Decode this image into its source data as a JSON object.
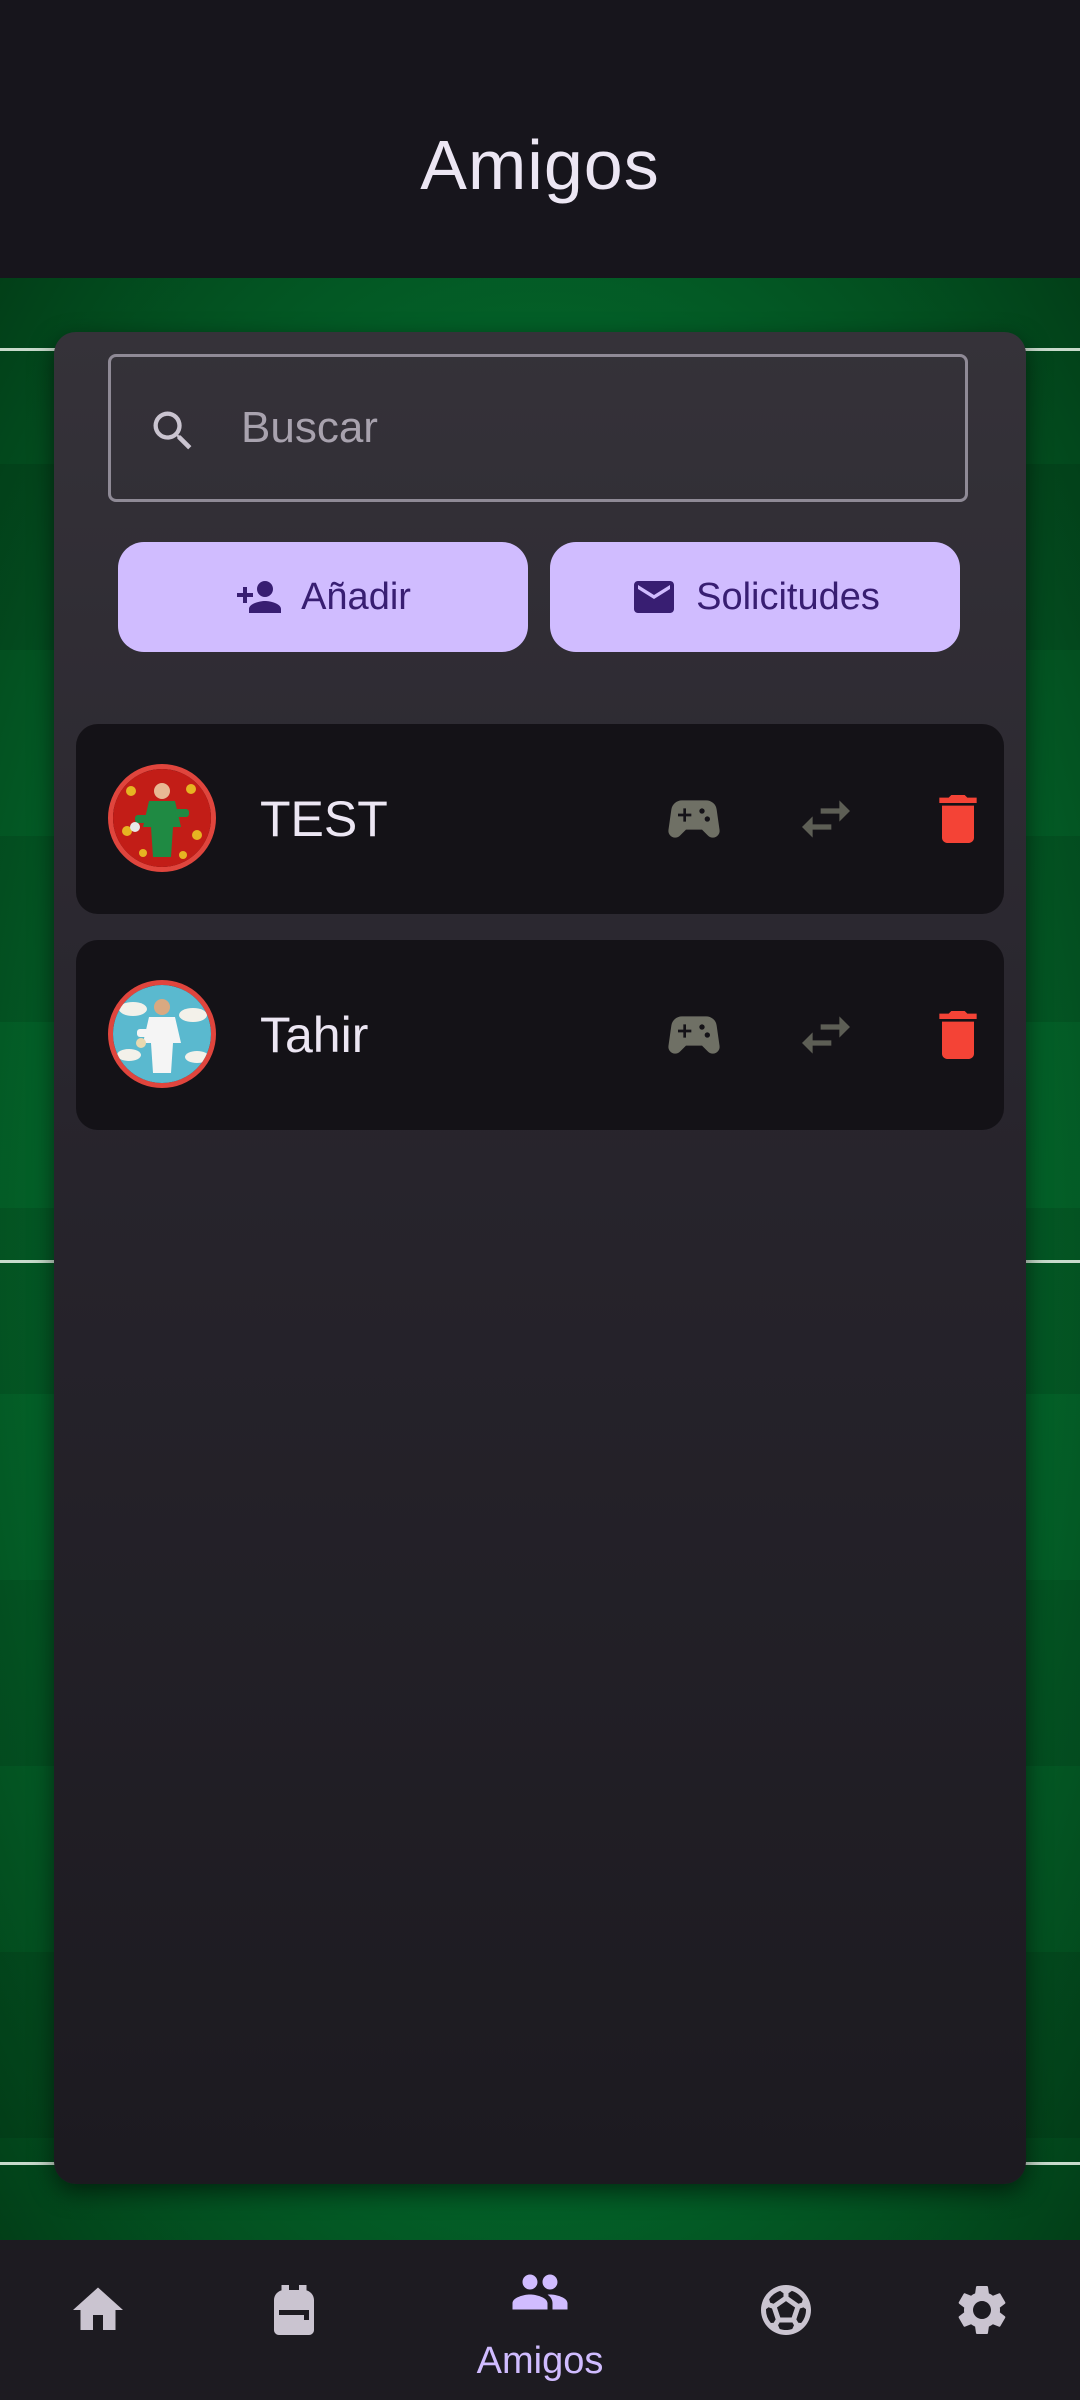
{
  "header": {
    "title": "Amigos"
  },
  "search": {
    "placeholder": "Buscar",
    "value": ""
  },
  "actions": {
    "add_label": "Añadir",
    "requests_label": "Solicitudes"
  },
  "friends": [
    {
      "name": "TEST"
    },
    {
      "name": "Tahir"
    }
  ],
  "bottom_nav": {
    "items": [
      {
        "icon": "home-icon"
      },
      {
        "icon": "backpack-icon"
      },
      {
        "icon": "people-icon",
        "label": "Amigos",
        "active": true
      },
      {
        "icon": "soccer-ball-icon"
      },
      {
        "icon": "settings-gear-icon"
      }
    ]
  },
  "colors": {
    "accent": "#d0bcff",
    "on_accent": "#381e72",
    "delete": "#f44336",
    "muted_icon": "#6f7065",
    "field_green": "#0a7d38"
  }
}
